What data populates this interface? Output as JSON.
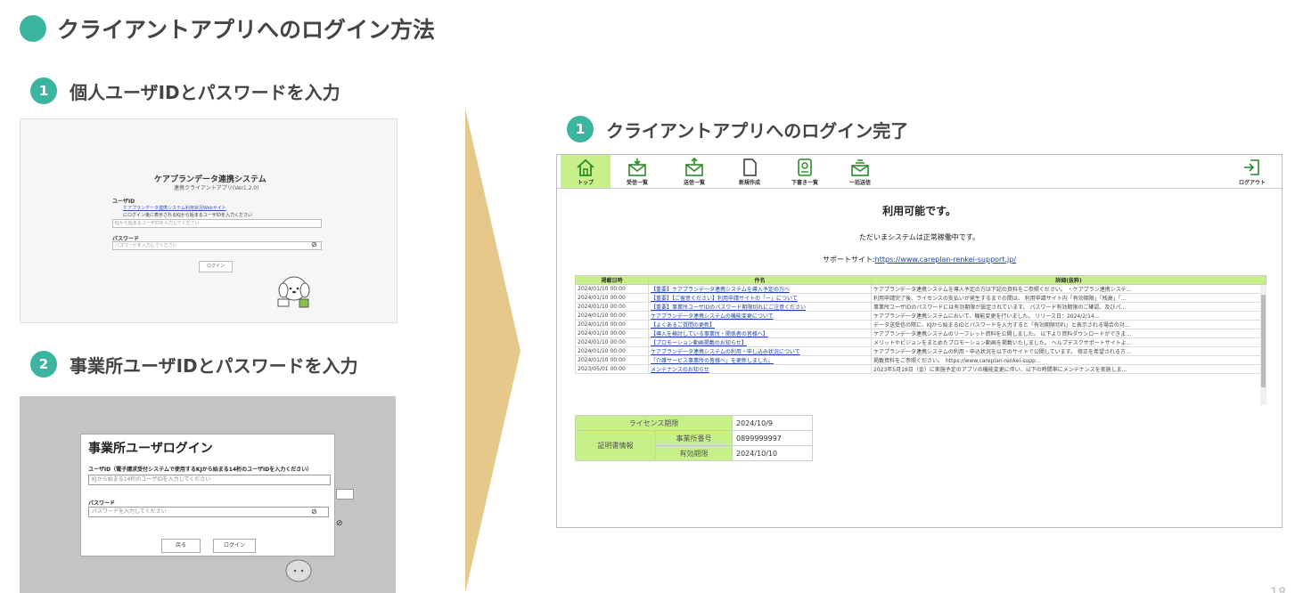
{
  "page": {
    "title": "クライアントアプリへのログイン方法",
    "page_number": "18"
  },
  "steps": {
    "step1_num": "1",
    "step1_text": "個人ユーザIDとパスワードを入力",
    "step2_num": "2",
    "step2_text": "事業所ユーザIDとパスワードを入力",
    "step3_num": "1",
    "step3_text": "クライアントアプリへのログイン完了"
  },
  "login1": {
    "system_title": "ケアプランデータ連携システム",
    "version": "連携クライアントアプリ(Ver1.2.0)",
    "userid_label": "ユーザID",
    "userid_link": "ケアプランデータ連携システム利用状況Webサイト",
    "userid_note": "にログイン後に表示されるKJから始まるユーザIDを入力ください",
    "userid_placeholder": "KJから始まるユーザIDを入力してください",
    "password_label": "パスワード",
    "password_placeholder": "パスワードを入力してください",
    "login_button": "ログイン"
  },
  "login2": {
    "dialog_title": "事業所ユーザログイン",
    "userid_label": "ユーザID（電子請求受付システムで使用するKJから始まる14桁のユーザIDを入力ください）",
    "userid_placeholder": "KJから始まる14桁のユーザIDを入力してください",
    "password_label": "パスワード",
    "password_placeholder": "パスワードを入力してください",
    "back_button": "戻る",
    "login_button": "ログイン"
  },
  "toolbar": {
    "top": "トップ",
    "inbox": "受信一覧",
    "sent": "送信一覧",
    "new": "新規作成",
    "drafts": "下書き一覧",
    "bulk_send": "一括送信",
    "logout": "ログアウト"
  },
  "main": {
    "status_title": "利用可能です。",
    "status_sub": "ただいまシステムは正常稼働中です。",
    "support_label": "サポートサイト:",
    "support_url": "https://www.careplan-renkei-support.jp/"
  },
  "news": {
    "headers": [
      "掲載日時",
      "件名",
      "詳細(抜粋)"
    ],
    "rows": [
      [
        "2024/01/10 00:00",
        "【重要】ケアプランデータ連携システムを導入予定の方へ",
        "ケアプランデータ連携システムを導入予定の方は下記の資料をご参照ください。 ・ケアプラン連携システ…"
      ],
      [
        "2024/01/10 00:00",
        "【重要】【ご留意ください】利用申請サイトの「ー」について",
        "利用申請完了後、ライセンスの支払いが発生するまでの間は、 利用申請サイト内「有効期限」「残高」「…"
      ],
      [
        "2024/01/10 00:00",
        "【重要】事業所ユーザIDのパスワード期限切れにご注意ください",
        "事業所ユーザIDのパスワードには有効期限が設定されています。 パスワード有効期限のご確認、及びパ…"
      ],
      [
        "2024/01/10 00:00",
        "ケアプランデータ連携システムの機能変更について",
        "ケアプランデータ連携システムにおいて、機能変更を行いました。 リリース日：2024/2/14…"
      ],
      [
        "2024/01/10 00:00",
        "【よくあるご質問の更新】",
        "データ送受信の際に、KJから始まるIDとパスワードを入力すると「有効期限切れ」と表示される場合の対…"
      ],
      [
        "2024/01/10 00:00",
        "【導入を検討している事業所・関係者の皆様へ】",
        "ケアプランデータ連携システムのリーフレット資料を公開しました。 以下より資料ダウンロードができま…"
      ],
      [
        "2024/01/10 00:00",
        "【プロモーション動画掲載のお知らせ】",
        "メリットやビジョンをまとめたプロモーション動画を掲載いたしました。 ヘルプデスクサポートサイトよ…"
      ],
      [
        "2024/01/10 00:00",
        "ケアプランデータ連携システムの利用・申し込み状況について",
        "ケアプランデータ連携システムの利用・申込状況を以下のサイトで公開しています。 修正を希望される方…"
      ],
      [
        "2024/01/10 00:00",
        "「介護サービス事業所の皆様へ」を更新しました。",
        "掲載資料をご参照ください。　https://www.careplan-renkei-supp…"
      ],
      [
        "2023/05/01 00:00",
        "メンテナンスのお知らせ",
        "2023年5月19日（金）に実施予定のアプリの機能変更に伴い、以下の時間帯にメンテナンスを実施しま…"
      ]
    ]
  },
  "license": {
    "license_label": "ライセンス期限",
    "license_value": "2024/10/9",
    "cert_label": "証明書情報",
    "office_label": "事業所番号",
    "office_value": "0899999997",
    "expiry_label": "有効期限",
    "expiry_value": "2024/10/10"
  },
  "colors": {
    "accent": "#3cb5a0",
    "toolbar_green": "#c8f08a",
    "chevron": "#e6c98a"
  }
}
